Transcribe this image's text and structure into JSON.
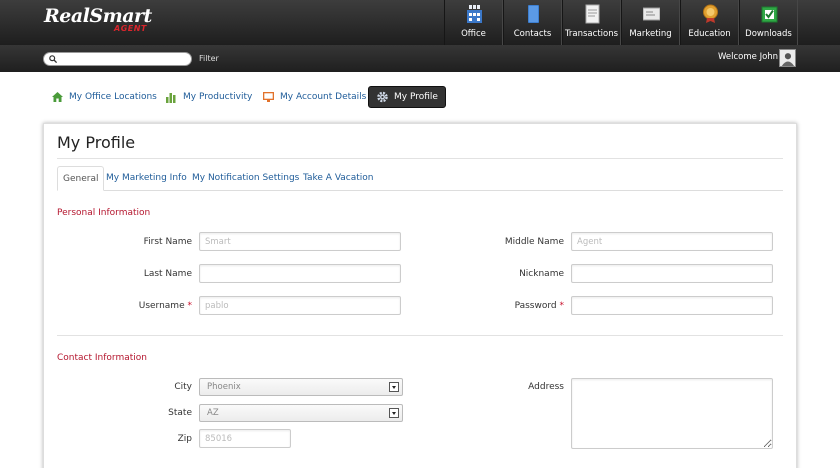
{
  "header": {
    "logo_text": "RealSmart",
    "logo_sub": "AGENT",
    "nav": [
      {
        "label": "Office",
        "icon": "office-icon"
      },
      {
        "label": "Contacts",
        "icon": "contacts-icon"
      },
      {
        "label": "Transactions",
        "icon": "transactions-icon"
      },
      {
        "label": "Marketing",
        "icon": "marketing-icon"
      },
      {
        "label": "Education",
        "icon": "education-icon"
      },
      {
        "label": "Downloads",
        "icon": "downloads-icon"
      }
    ],
    "search_placeholder": "",
    "filter_label": "Filter",
    "welcome": "Welcome John"
  },
  "subnav": [
    {
      "label": "My Office Locations",
      "icon": "house-icon"
    },
    {
      "label": "My Productivity",
      "icon": "bar-chart-icon"
    },
    {
      "label": "My Account Details",
      "icon": "monitor-icon"
    },
    {
      "label": "My Profile",
      "icon": "gear-icon",
      "active": true
    }
  ],
  "profile": {
    "title": "My Profile",
    "tabs": [
      "General",
      "My Marketing Info",
      "My Notification Settings",
      "Take A Vacation"
    ],
    "personal_section": "Personal Information",
    "contact_section": "Contact Information",
    "fields": {
      "first_name": {
        "label": "First Name",
        "placeholder": "Smart"
      },
      "middle_name": {
        "label": "Middle Name",
        "placeholder": "Agent"
      },
      "last_name": {
        "label": "Last Name",
        "placeholder": ""
      },
      "nickname": {
        "label": "Nickname",
        "placeholder": ""
      },
      "username": {
        "label": "Username",
        "placeholder": "pablo",
        "required_mark": "*"
      },
      "password": {
        "label": "Password",
        "placeholder": "",
        "required_mark": "*"
      },
      "city": {
        "label": "City",
        "value": "Phoenix"
      },
      "state": {
        "label": "State",
        "value": "AZ"
      },
      "zip": {
        "label": "Zip",
        "placeholder": "85016"
      },
      "address": {
        "label": "Address"
      }
    }
  },
  "colors": {
    "accent_link": "#1f5c99",
    "section_red": "#b5172f",
    "required_red": "#c9102c"
  }
}
